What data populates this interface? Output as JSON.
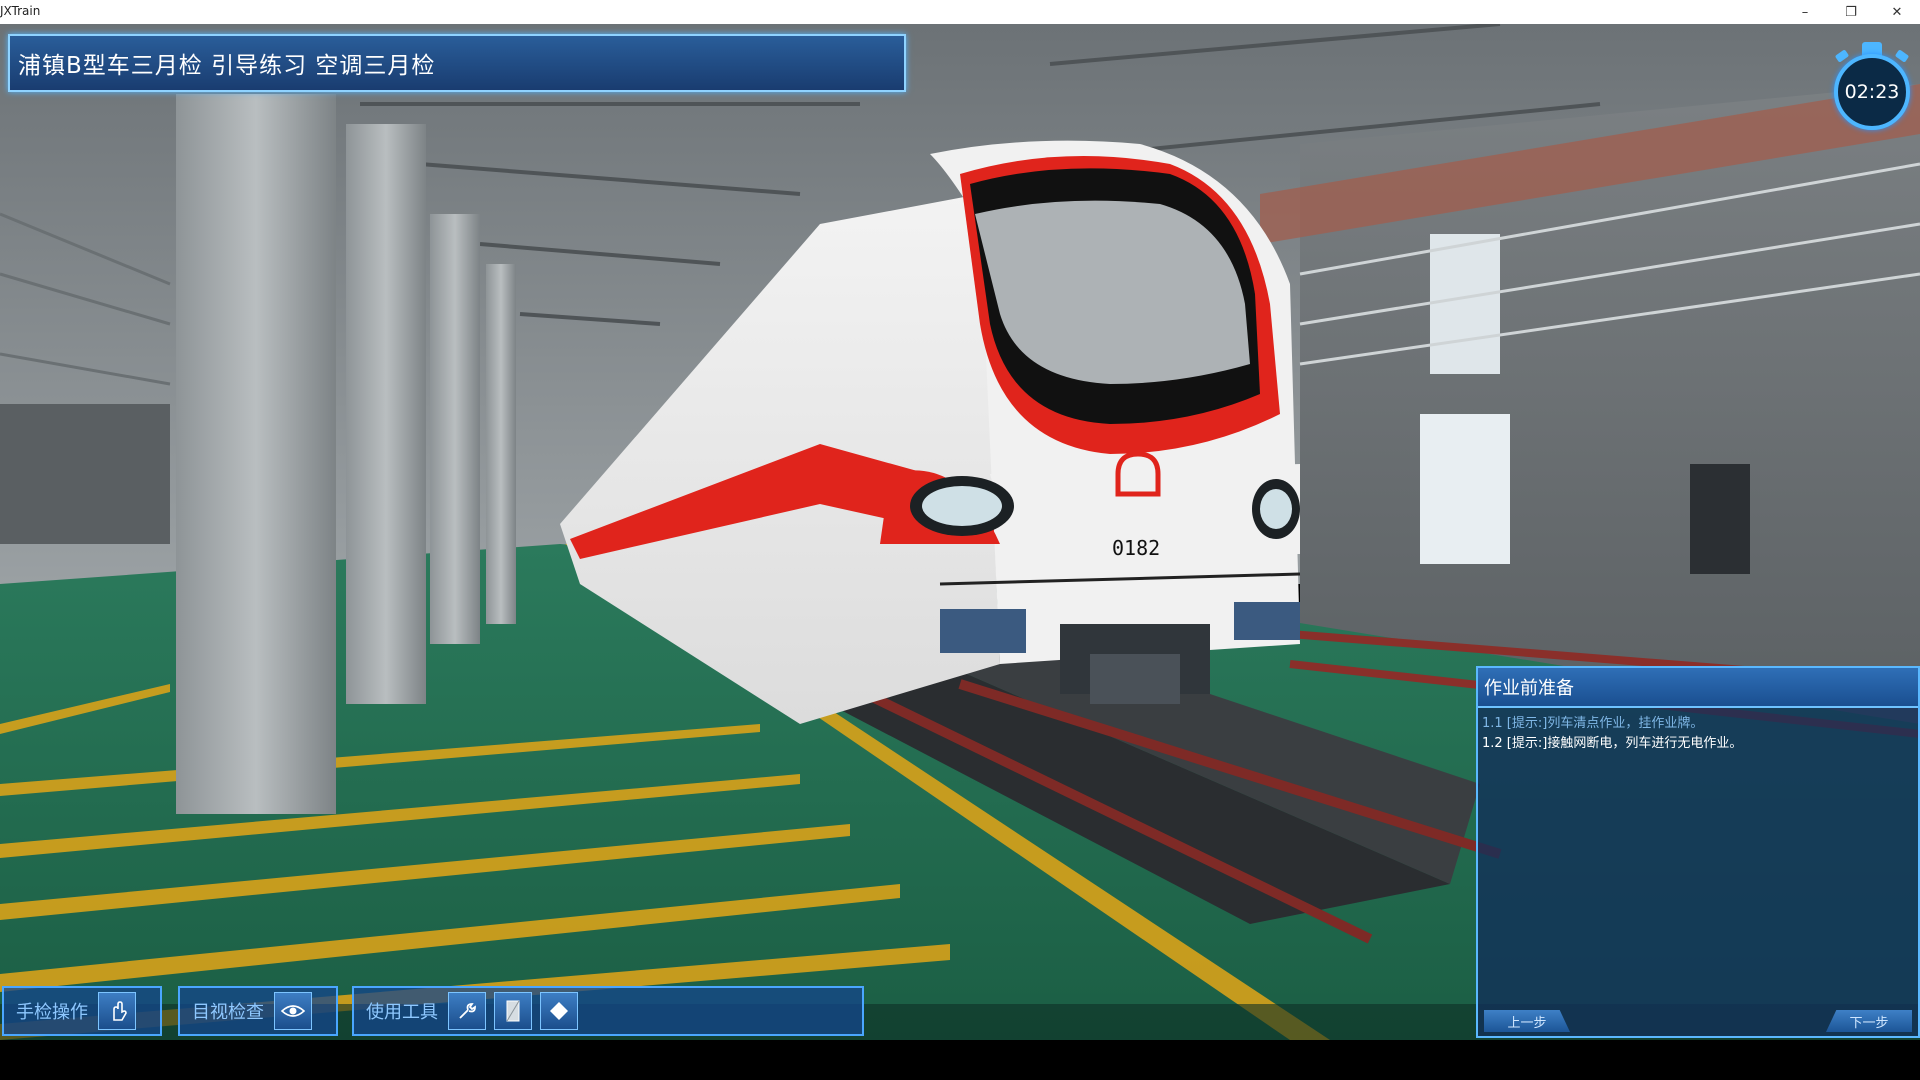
{
  "window": {
    "app_title": "JXTrain",
    "minimize_glyph": "–",
    "restore_glyph": "❐",
    "close_glyph": "✕"
  },
  "banner": {
    "title": "浦镇B型车三月检 引导练习 空调三月检"
  },
  "timer": {
    "value": "02:23"
  },
  "train": {
    "number": "0182"
  },
  "task_panel": {
    "header": "作业前准备",
    "items": [
      {
        "text": "1.1 [提示:]列车清点作业，挂作业牌。",
        "state": "done"
      },
      {
        "text": "1.2 [提示:]接触网断电，列车进行无电作业。",
        "state": "active"
      }
    ],
    "prev_label": "上一步",
    "next_label": "下一步"
  },
  "toolbar": {
    "manual": {
      "label": "手检操作",
      "icon": "hand-icon"
    },
    "visual": {
      "label": "目视检查",
      "icon": "eye-icon"
    },
    "tools": {
      "label": "使用工具",
      "items": [
        {
          "icon": "wrench-icon"
        },
        {
          "icon": "tablet-icon"
        },
        {
          "icon": "diamond-icon"
        }
      ]
    }
  },
  "colors": {
    "panel_border": "#5ab8ff",
    "train_red": "#e0241c",
    "floor_green": "#1f6e52",
    "floor_stripe": "#d8a21a"
  }
}
